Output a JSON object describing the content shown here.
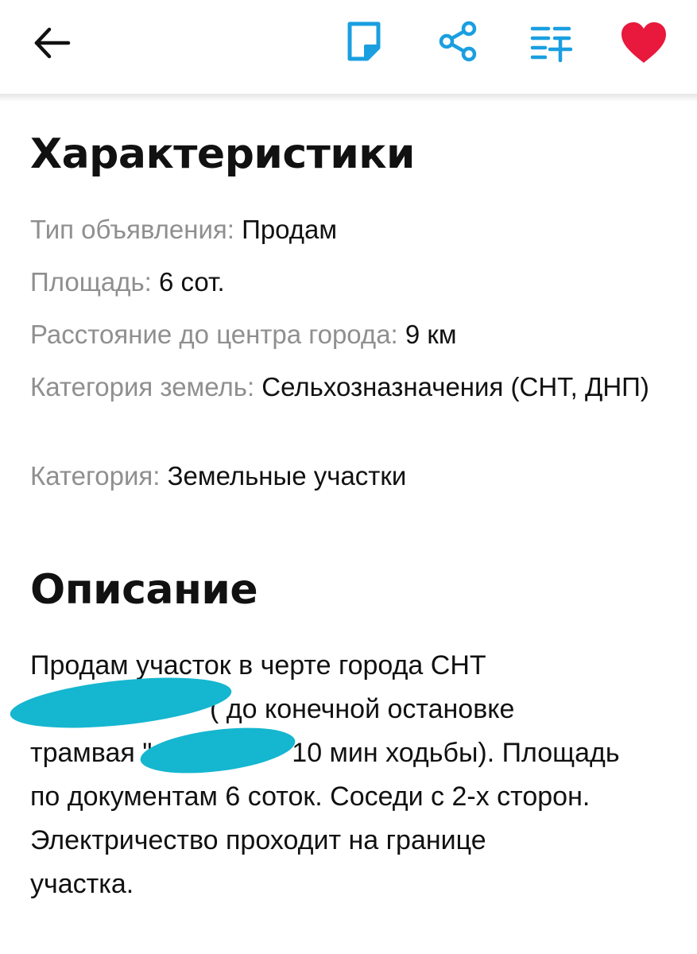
{
  "toolbar": {
    "back_icon": "arrow-left-icon",
    "note_icon": "note-icon",
    "share_icon": "share-icon",
    "add_to_list_icon": "playlist-add-icon",
    "favorite_icon": "heart-icon",
    "accent_color": "#1a9fe0",
    "favorite_color": "#e8193c"
  },
  "characteristics": {
    "title": "Характеристики",
    "items": [
      {
        "label": "Тип объявления:",
        "value": "Продам"
      },
      {
        "label": "Площадь:",
        "value": "6 сот."
      },
      {
        "label": "Расстояние до центра города:",
        "value": "9 км"
      },
      {
        "label": "Категория земель:",
        "value": "Сельхозназначения (СНТ, ДНП)"
      },
      {
        "label": "Категория:",
        "value": "Земельные участки"
      }
    ]
  },
  "description": {
    "title": "Описание",
    "line1": "Продам участок в черте города СНТ",
    "line2": "( до конечной остановке",
    "line3_start": "трамвая \"",
    "line3_end": "10 мин ходьбы). Площадь",
    "line4": "по документам 6 соток. Соседи с 2-х сторон.",
    "line5": "Электричество проходит на границе",
    "line6": "участка.",
    "redaction_color": "#15b6cf"
  }
}
